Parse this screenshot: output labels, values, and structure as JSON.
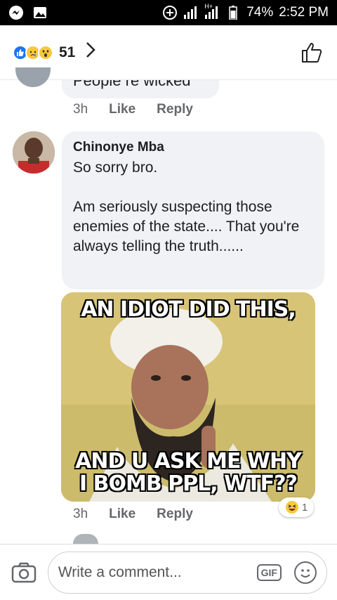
{
  "status_bar": {
    "battery": "74%",
    "time": "2:52 PM",
    "network": "H+"
  },
  "header": {
    "reaction_count": "51",
    "reactions": [
      "like",
      "sad",
      "wow"
    ]
  },
  "previous_comment": {
    "text": "People re wicked",
    "time": "3h",
    "like_label": "Like",
    "reply_label": "Reply"
  },
  "comment": {
    "author": "Chinonye Mba",
    "text": "So sorry bro.\n\nAm seriously suspecting those enemies of the state.... That you're always telling the truth......",
    "meme_top": "AN IDIOT DID THIS,",
    "meme_bottom_1": "AND U ASK ME WHY",
    "meme_bottom_2": "I BOMB PPL, WTF??",
    "time": "3h",
    "like_label": "Like",
    "reply_label": "Reply",
    "reaction_count": "1",
    "reaction": "haha"
  },
  "composer": {
    "placeholder": "Write a comment...",
    "gif_label": "GIF"
  },
  "colors": {
    "like_blue": "#1877f2",
    "bubble_bg": "#f0f2f5",
    "meta_gray": "#65676b"
  }
}
